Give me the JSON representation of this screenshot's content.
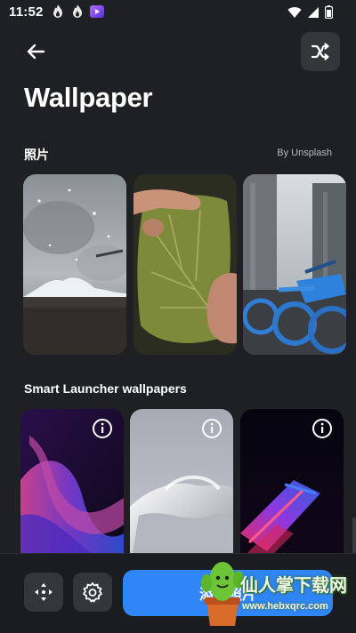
{
  "status_bar": {
    "time": "11:52",
    "left_icons": [
      "fire-icon",
      "fire-icon",
      "media-app-icon"
    ],
    "right_icons": [
      "wifi-icon",
      "cell-signal-icon",
      "battery-icon"
    ]
  },
  "header": {
    "back_icon": "arrow-left-icon",
    "shuffle_icon": "shuffle-icon",
    "title": "Wallpaper"
  },
  "photos_section": {
    "title": "照片",
    "attribution": "By Unsplash",
    "items": [
      {
        "subject": "snowy-landscape"
      },
      {
        "subject": "hands-holding-leaf"
      },
      {
        "subject": "city-bikes"
      }
    ]
  },
  "launcher_section": {
    "title": "Smart Launcher wallpapers",
    "items": [
      {
        "subject": "abstract-purple-waves",
        "info_icon": "info-icon"
      },
      {
        "subject": "abstract-silver-shape",
        "info_icon": "info-icon"
      },
      {
        "subject": "abstract-neon-lights",
        "info_icon": "info-icon"
      }
    ]
  },
  "bottom_bar": {
    "move_icon": "move-arrows-icon",
    "settings_icon": "gear-icon",
    "primary_label": "添加照片"
  },
  "watermark": {
    "text": "仙人掌下载网",
    "url": "www.hebxqrc.com"
  },
  "colors": {
    "background": "#1f2024",
    "surface": "#34363a",
    "accent": "#2f86f6"
  }
}
